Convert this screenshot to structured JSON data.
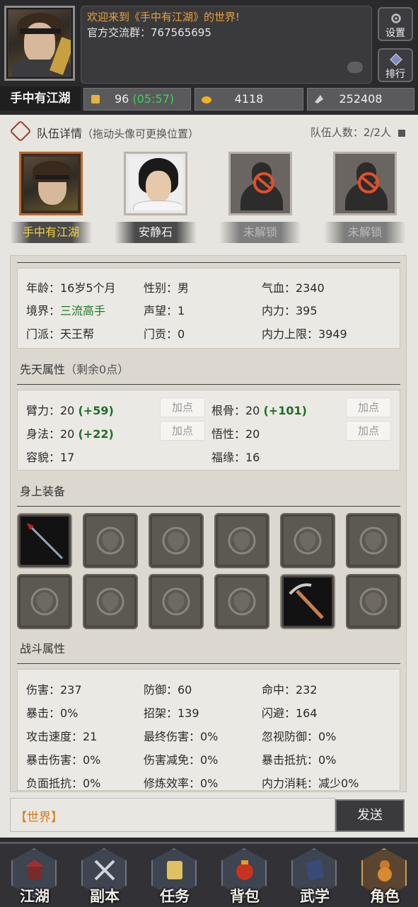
{
  "header": {
    "welcome": "欢迎来到《手中有江湖》的世界!",
    "group": "官方交流群：767565695",
    "settings_label": "设置",
    "rank_label": "排行",
    "player_name": "手中有江湖"
  },
  "resources": {
    "stamina": "96",
    "stamina_timer": "(05:57)",
    "gold": "4118",
    "silver": "252408"
  },
  "team": {
    "title": "队伍详情",
    "subtitle": "（拖动头像可更换位置）",
    "count": "队伍人数：2/2人",
    "slots": [
      {
        "name": "手中有江湖"
      },
      {
        "name": "安静石"
      },
      {
        "name": "未解锁"
      },
      {
        "name": "未解锁"
      }
    ]
  },
  "profile": {
    "age": "年龄：16岁5个月",
    "gender": "性别：男",
    "hp": "气血：2340",
    "realm_label": "境界：",
    "realm_value": "三流高手",
    "prestige": "声望：1",
    "mp": "内力：395",
    "sect": "门派：天王帮",
    "contribution": "门贡：0",
    "mp_max": "内力上限：3949"
  },
  "innate": {
    "title": "先天属性",
    "remaining": "（剩余0点）",
    "add_label": "加点",
    "strength": "臂力：20",
    "strength_bonus": "(+59)",
    "constitution": "根骨：20",
    "constitution_bonus": "(+101)",
    "agility": "身法：20",
    "agility_bonus": "(+22)",
    "comprehension": "悟性：20",
    "looks": "容貌：17",
    "luck": "福缘：16"
  },
  "equipment": {
    "title": "身上装备",
    "slots": [
      {
        "icon": "spear-icon",
        "filled": true
      },
      {
        "icon": "hidden-weapon-icon",
        "filled": false
      },
      {
        "icon": "robe-icon",
        "filled": false
      },
      {
        "icon": "armor-icon",
        "filled": false
      },
      {
        "icon": "boots-icon",
        "filled": false
      },
      {
        "icon": "amulet-icon",
        "filled": false
      },
      {
        "icon": "bracelet-icon",
        "filled": false
      },
      {
        "icon": "pouch-icon",
        "filled": false
      },
      {
        "icon": "beads-icon",
        "filled": false
      },
      {
        "icon": "ring-icon",
        "filled": false
      },
      {
        "icon": "pickaxe-icon",
        "filled": true
      },
      {
        "icon": "horse-icon",
        "filled": false
      }
    ]
  },
  "combat": {
    "title": "战斗属性",
    "rows": [
      [
        "伤害：237",
        "防御：60",
        "命中：232"
      ],
      [
        "暴击：0%",
        "招架：139",
        "闪避：164"
      ],
      [
        "攻击速度：21",
        "最终伤害：0%",
        "忽视防御：0%"
      ],
      [
        "暴击伤害：0%",
        "伤害减免：0%",
        "暴击抵抗：0%"
      ],
      [
        "负面抵抗：0%",
        "修炼效率：0%",
        "内力消耗：减少0%"
      ]
    ]
  },
  "chat": {
    "channel": "【世界】",
    "send_label": "发送"
  },
  "nav": [
    {
      "label": "江湖",
      "icon": "pagoda-icon"
    },
    {
      "label": "副本",
      "icon": "crossed-swords-icon"
    },
    {
      "label": "任务",
      "icon": "scroll-icon"
    },
    {
      "label": "背包",
      "icon": "bag-icon"
    },
    {
      "label": "武学",
      "icon": "book-icon"
    },
    {
      "label": "角色",
      "icon": "gourd-icon"
    }
  ],
  "colors": {
    "accent_orange": "#e8a23c",
    "timer_green": "#3cd05a",
    "realm_green": "#1f7a28",
    "leader_gold": "#f2d23a",
    "chat_orange": "#d97a1c"
  }
}
